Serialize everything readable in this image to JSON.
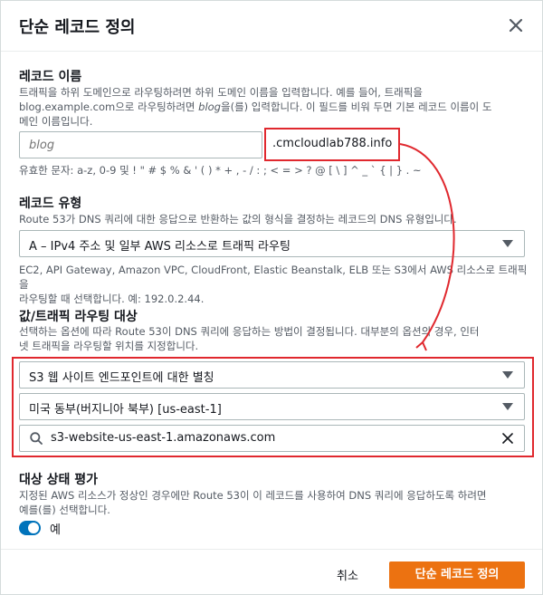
{
  "modal": {
    "title": "단순 레코드 정의"
  },
  "record_name": {
    "label": "레코드 이름",
    "description_part1": "트래픽을 하위 도메인으로 라우팅하려면 하위 도메인 이름을 입력합니다. 예를 들어, 트래픽을",
    "description_part2_prefix": "blog.example.com으로 라우팅하려면 ",
    "description_part2_italic": "blog",
    "description_part2_suffix": "을(를) 입력합니다. 이 필드를 비워 두면 기본 레코드 이름이 도",
    "description_part3": "메인 이름입니다.",
    "placeholder": "blog",
    "domain_suffix": ".cmcloudlab788.info",
    "valid_chars": "유효한 문자: a-z, 0-9 및 ! \" # $ % & ' ( ) * + , - / : ; < = > ? @ [ \\ ] ^ _ ` { | } . ~"
  },
  "record_type": {
    "label": "레코드 유형",
    "description": "Route 53가 DNS 쿼리에 대한 응답으로 반환하는 값의 형식을 결정하는 레코드의 DNS 유형입니다.",
    "selected": "A – IPv4 주소 및 일부 AWS 리소스로 트래픽 라우팅",
    "help_line1": "EC2, API Gateway, Amazon VPC, CloudFront, Elastic Beanstalk, ELB 또는 S3에서 AWS 리소스로 트래픽을",
    "help_line2": "라우팅할 때 선택합니다. 예: 192.0.2.44."
  },
  "value_target": {
    "label": "값/트래픽 라우팅 대상",
    "description_line1": "선택하는 옵션에 따라 Route 53이 DNS 쿼리에 응답하는 방법이 결정됩니다. 대부분의 옵션의 경우, 인터",
    "description_line2": "넷 트래픽을 라우팅할 위치를 지정합니다.",
    "endpoint_selected": "S3 웹 사이트 엔드포인트에 대한 별칭",
    "region_selected": "미국 동부(버지니아 북부) [us-east-1]",
    "endpoint_value": "s3-website-us-east-1.amazonaws.com"
  },
  "health": {
    "label": "대상 상태 평가",
    "description_line1": "지정된 AWS 리소스가 정상인 경우에만 Route 53이 이 레코드를 사용하여 DNS 쿼리에 응답하도록 하려면",
    "description_line2": "예를(를) 선택합니다.",
    "toggle_label": "예",
    "toggle_on": true
  },
  "footer": {
    "cancel_label": "취소",
    "submit_label": "단순 레코드 정의"
  },
  "colors": {
    "accent": "#ec7211",
    "toggle": "#0073bb",
    "annotation": "#e0282e"
  },
  "icons": [
    "close-icon",
    "search-icon",
    "clear-icon",
    "caret-down-icon"
  ]
}
